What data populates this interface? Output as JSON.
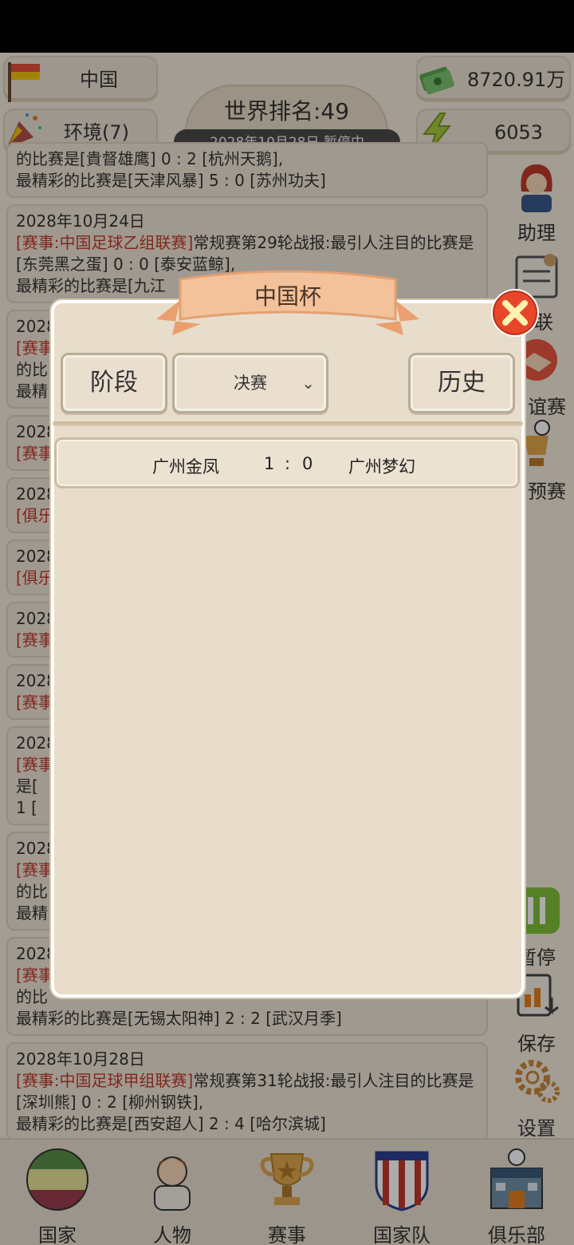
{
  "hud": {
    "country": "中国",
    "environment": "环境(7)",
    "world_rank": "世界排名:49",
    "date_status": "2028年10月28日  暂停中",
    "money": "8720.91万",
    "energy": "6053"
  },
  "news": [
    {
      "date": "",
      "tag": "",
      "text": "的比赛是[貴督雄鹰] 0 : 2 [杭州天鹅],",
      "best": "最精彩的比赛是[天津风暴] 5 : 0 [苏州功夫]"
    },
    {
      "date": "2028年10月24日",
      "tag": "[赛事:中国足球乙组联赛]",
      "text": "常规赛第29轮战报:最引人注目的比赛是[东莞黑之蛋] 0 : 0 [泰安蓝鲸],",
      "best": "最精彩的比赛是[九江"
    },
    {
      "date": "2028",
      "tag": "[赛事",
      "text": "的比",
      "best": "最精"
    },
    {
      "date": "2028",
      "tag": "[赛事",
      "text": "",
      "best": ""
    },
    {
      "date": "2028",
      "tag": "[俱乐",
      "text": "",
      "best": ""
    },
    {
      "date": "2028",
      "tag": "[俱乐",
      "text": "",
      "best": ""
    },
    {
      "date": "2028",
      "tag": "[赛事",
      "text": "",
      "best": ""
    },
    {
      "date": "2028",
      "tag": "[赛事",
      "text": "",
      "best": ""
    },
    {
      "date": "2028",
      "tag": "[赛事",
      "text": "是[",
      "best": "1 ["
    },
    {
      "date": "2028",
      "tag": "[赛事",
      "text": "的比",
      "best": "最精"
    },
    {
      "date": "2028",
      "tag": "[赛事",
      "text": "的比",
      "best": "最精彩的比赛是[无锡太阳神] 2 : 2 [武汉月季]"
    },
    {
      "date": "2028年10月28日",
      "tag": "[赛事:中国足球甲组联赛]",
      "text": "常规赛第31轮战报:最引人注目的比赛是[深圳熊] 0 : 2 [柳州钢铁],",
      "best": "最精彩的比赛是[西安超人] 2 : 4 [哈尔滨城]"
    }
  ],
  "side_menu": {
    "assistant": "助理",
    "league": "联",
    "friendly": "谊赛",
    "qualifier": "预赛",
    "pause": "暂停",
    "save": "保存",
    "settings": "设置"
  },
  "bottom_nav": [
    "国家",
    "人物",
    "赛事",
    "国家队",
    "俱乐部"
  ],
  "dialog": {
    "title": "中国杯",
    "stage_label": "阶段",
    "stage_value": "决赛",
    "history_label": "历史",
    "matches": [
      {
        "home": "广州金凤",
        "score_home": "1",
        "sep": ":",
        "score_away": "0",
        "away": "广州梦幻"
      }
    ]
  },
  "colors": {
    "accent_red": "#c0392b",
    "panel": "#e8ddcb",
    "close_button": "#e8462a"
  }
}
